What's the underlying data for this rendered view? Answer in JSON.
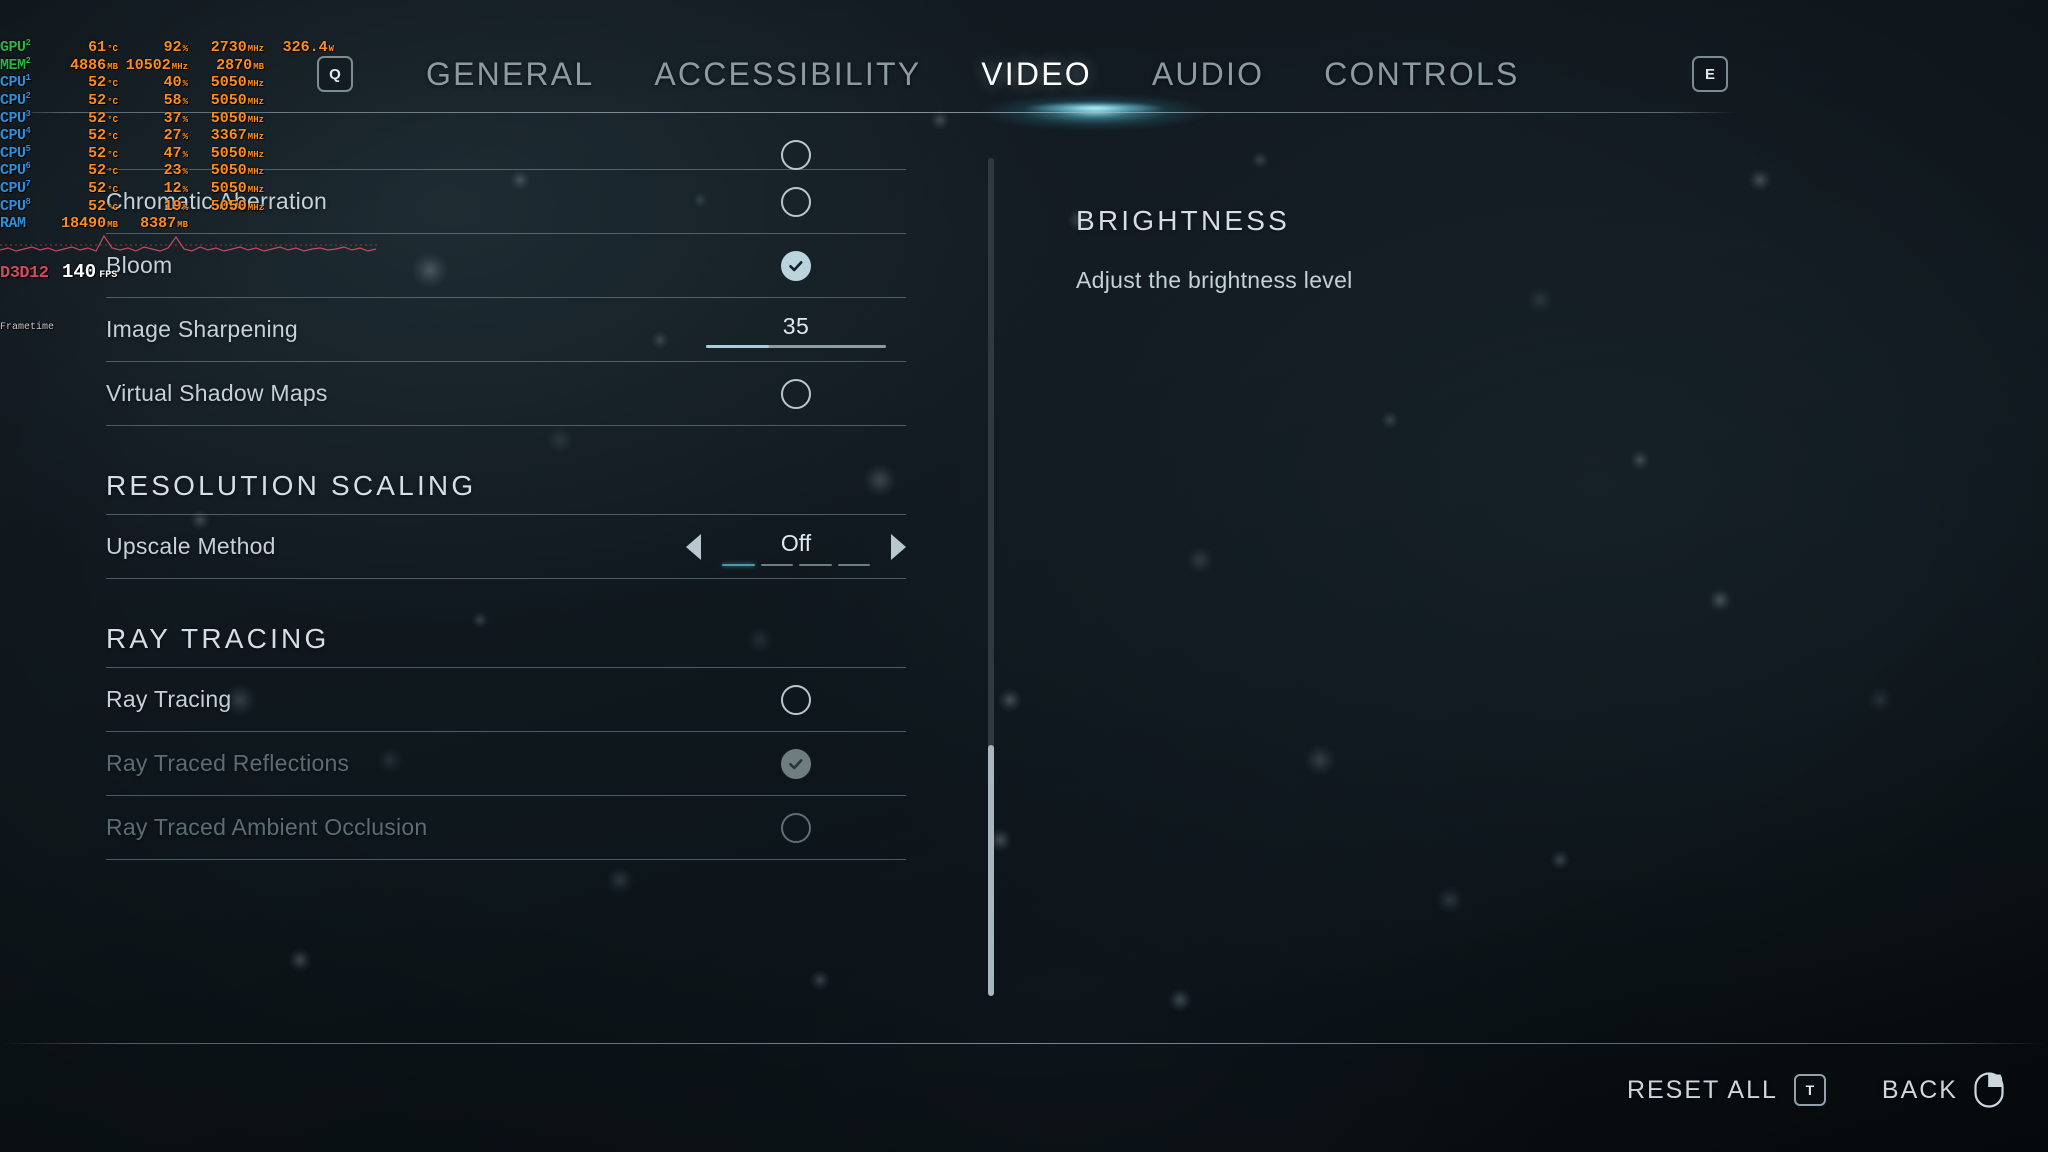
{
  "theme": {
    "accent": "#a9ced9",
    "accent_teal": "#4e9aa8",
    "text_primary": "#ffffff",
    "text_secondary": "#c4d1d8",
    "text_disabled": "#5d6c74",
    "background": "#0e171c",
    "divider": "#a3b6c0"
  },
  "perf_overlay": {
    "rows": [
      {
        "label": "GPU",
        "index": "2",
        "c1": "61",
        "u1": "°C",
        "c2": "92",
        "u2": "%",
        "c3": "2730",
        "u3": "MHz",
        "c4": "326.4",
        "u4": "W"
      },
      {
        "label": "MEM",
        "index": "2",
        "c1": "4886",
        "u1": "MB",
        "c2": "10502",
        "u2": "MHz",
        "c3": "2870",
        "u3": "MB",
        "c4": "",
        "u4": ""
      },
      {
        "label": "CPU",
        "index": "1",
        "c1": "52",
        "u1": "°C",
        "c2": "40",
        "u2": "%",
        "c3": "5050",
        "u3": "MHz",
        "c4": "",
        "u4": ""
      },
      {
        "label": "CPU",
        "index": "2",
        "c1": "52",
        "u1": "°C",
        "c2": "58",
        "u2": "%",
        "c3": "5050",
        "u3": "MHz",
        "c4": "",
        "u4": ""
      },
      {
        "label": "CPU",
        "index": "3",
        "c1": "52",
        "u1": "°C",
        "c2": "37",
        "u2": "%",
        "c3": "5050",
        "u3": "MHz",
        "c4": "",
        "u4": ""
      },
      {
        "label": "CPU",
        "index": "4",
        "c1": "52",
        "u1": "°C",
        "c2": "27",
        "u2": "%",
        "c3": "3367",
        "u3": "MHz",
        "c4": "",
        "u4": ""
      },
      {
        "label": "CPU",
        "index": "5",
        "c1": "52",
        "u1": "°C",
        "c2": "47",
        "u2": "%",
        "c3": "5050",
        "u3": "MHz",
        "c4": "",
        "u4": ""
      },
      {
        "label": "CPU",
        "index": "6",
        "c1": "52",
        "u1": "°C",
        "c2": "23",
        "u2": "%",
        "c3": "5050",
        "u3": "MHz",
        "c4": "",
        "u4": ""
      },
      {
        "label": "CPU",
        "index": "7",
        "c1": "52",
        "u1": "°C",
        "c2": "12",
        "u2": "%",
        "c3": "5050",
        "u3": "MHz",
        "c4": "",
        "u4": ""
      },
      {
        "label": "CPU",
        "index": "8",
        "c1": "52",
        "u1": "°C",
        "c2": "19",
        "u2": "%",
        "c3": "5050",
        "u3": "MHz",
        "c4": "",
        "u4": ""
      },
      {
        "label": "RAM",
        "index": "",
        "c1": "18490",
        "u1": "MB",
        "c2": "8387",
        "u2": "MB",
        "c3": "",
        "u3": "",
        "c4": "",
        "u4": ""
      }
    ],
    "api": "D3D12",
    "fps": "140",
    "fps_unit": "FPS",
    "frametime_label": "Frametime"
  },
  "header": {
    "key_left": "Q",
    "key_right": "E",
    "tabs": [
      {
        "label": "GENERAL",
        "active": false
      },
      {
        "label": "ACCESSIBILITY",
        "active": false
      },
      {
        "label": "VIDEO",
        "active": true
      },
      {
        "label": "AUDIO",
        "active": false
      },
      {
        "label": "CONTROLS",
        "active": false
      }
    ]
  },
  "settings": {
    "items": [
      {
        "kind": "clipped",
        "label": "",
        "control": "checkbox",
        "checked": false,
        "disabled": false
      },
      {
        "kind": "row",
        "label": "Chromatic Aberration",
        "control": "checkbox",
        "checked": false,
        "disabled": false
      },
      {
        "kind": "row",
        "label": "Bloom",
        "control": "checkbox",
        "checked": true,
        "disabled": false
      },
      {
        "kind": "row",
        "label": "Image Sharpening",
        "control": "slider",
        "value": "35",
        "percent": 35,
        "disabled": false
      },
      {
        "kind": "row",
        "label": "Virtual Shadow Maps",
        "control": "checkbox",
        "checked": false,
        "disabled": false
      },
      {
        "kind": "section",
        "label": "RESOLUTION SCALING"
      },
      {
        "kind": "row",
        "label": "Upscale Method",
        "control": "stepper",
        "value": "Off",
        "segments": 4,
        "active_segment": 0,
        "disabled": false
      },
      {
        "kind": "section",
        "label": "RAY TRACING"
      },
      {
        "kind": "row",
        "label": "Ray Tracing",
        "control": "checkbox",
        "checked": false,
        "disabled": false
      },
      {
        "kind": "row",
        "label": "Ray Traced Reflections",
        "control": "checkbox",
        "checked": true,
        "disabled": true
      },
      {
        "kind": "row",
        "label": "Ray Traced Ambient Occlusion",
        "control": "checkbox",
        "checked": false,
        "disabled": true
      }
    ]
  },
  "description": {
    "title": "BRIGHTNESS",
    "body": "Adjust the brightness level"
  },
  "footer": {
    "reset_label": "RESET ALL",
    "reset_key": "T",
    "back_label": "BACK",
    "back_icon": "mouse-right-button-icon"
  }
}
